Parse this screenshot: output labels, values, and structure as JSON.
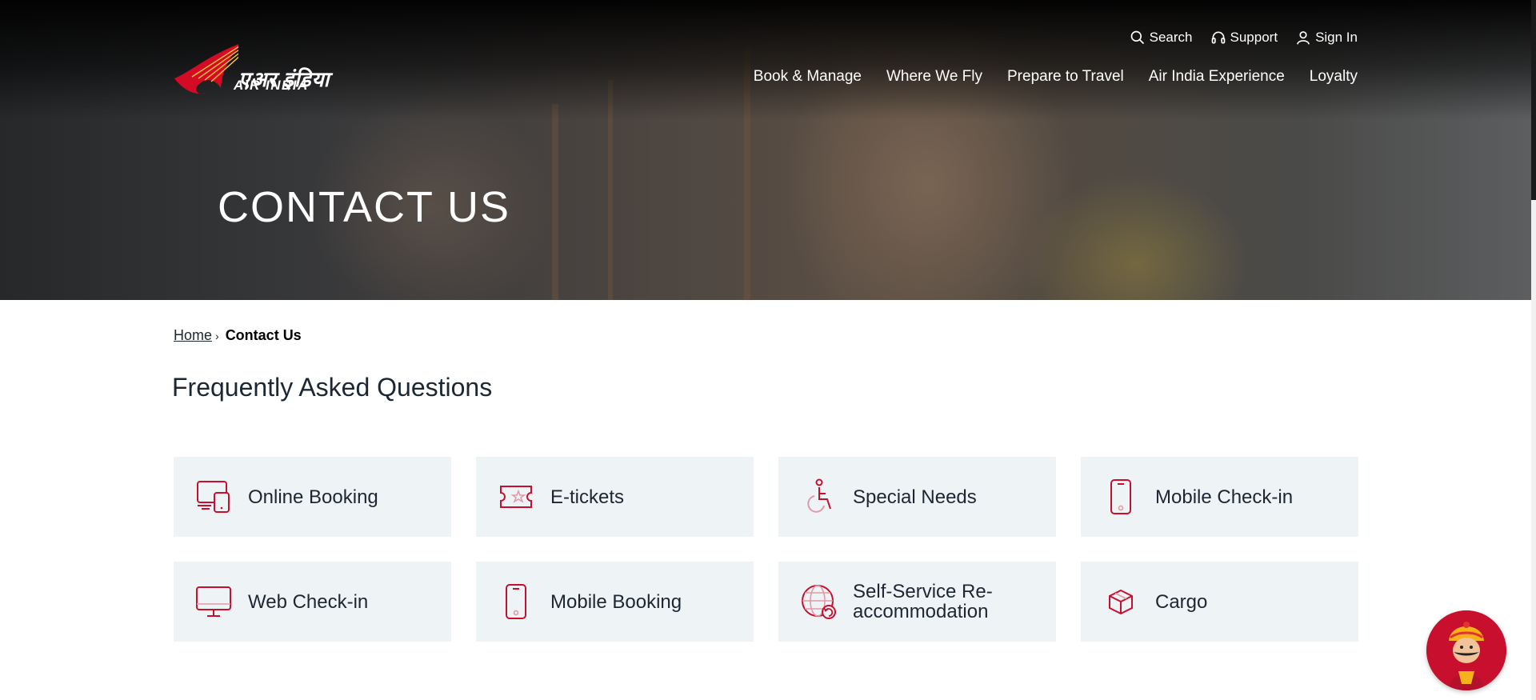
{
  "header": {
    "logo": {
      "hindi_text": "एअर इंडिया",
      "english_text": "AIR INDIA"
    },
    "utility_nav": [
      {
        "label": "Search",
        "icon": "search-icon"
      },
      {
        "label": "Support",
        "icon": "headset-icon"
      },
      {
        "label": "Sign In",
        "icon": "user-icon"
      }
    ],
    "main_nav": [
      {
        "label": "Book & Manage"
      },
      {
        "label": "Where We Fly"
      },
      {
        "label": "Prepare to Travel"
      },
      {
        "label": "Air India Experience"
      },
      {
        "label": "Loyalty"
      }
    ]
  },
  "hero": {
    "title": "CONTACT US"
  },
  "breadcrumb": {
    "home": "Home",
    "current": "Contact Us"
  },
  "faq": {
    "title": "Frequently Asked Questions",
    "cards": [
      {
        "label": "Online Booking",
        "icon": "devices-icon"
      },
      {
        "label": "E-tickets",
        "icon": "ticket-icon"
      },
      {
        "label": "Special Needs",
        "icon": "wheelchair-icon"
      },
      {
        "label": "Mobile Check-in",
        "icon": "mobile-icon"
      },
      {
        "label": "Web Check-in",
        "icon": "monitor-icon"
      },
      {
        "label": "Mobile Booking",
        "icon": "mobile-icon"
      },
      {
        "label": "Self-Service Re-accommodation",
        "icon": "globe-refresh-icon"
      },
      {
        "label": "Cargo",
        "icon": "package-icon"
      }
    ]
  },
  "colors": {
    "accent": "#c8102e",
    "card_bg": "#eef3f6",
    "text": "#1c2733"
  }
}
